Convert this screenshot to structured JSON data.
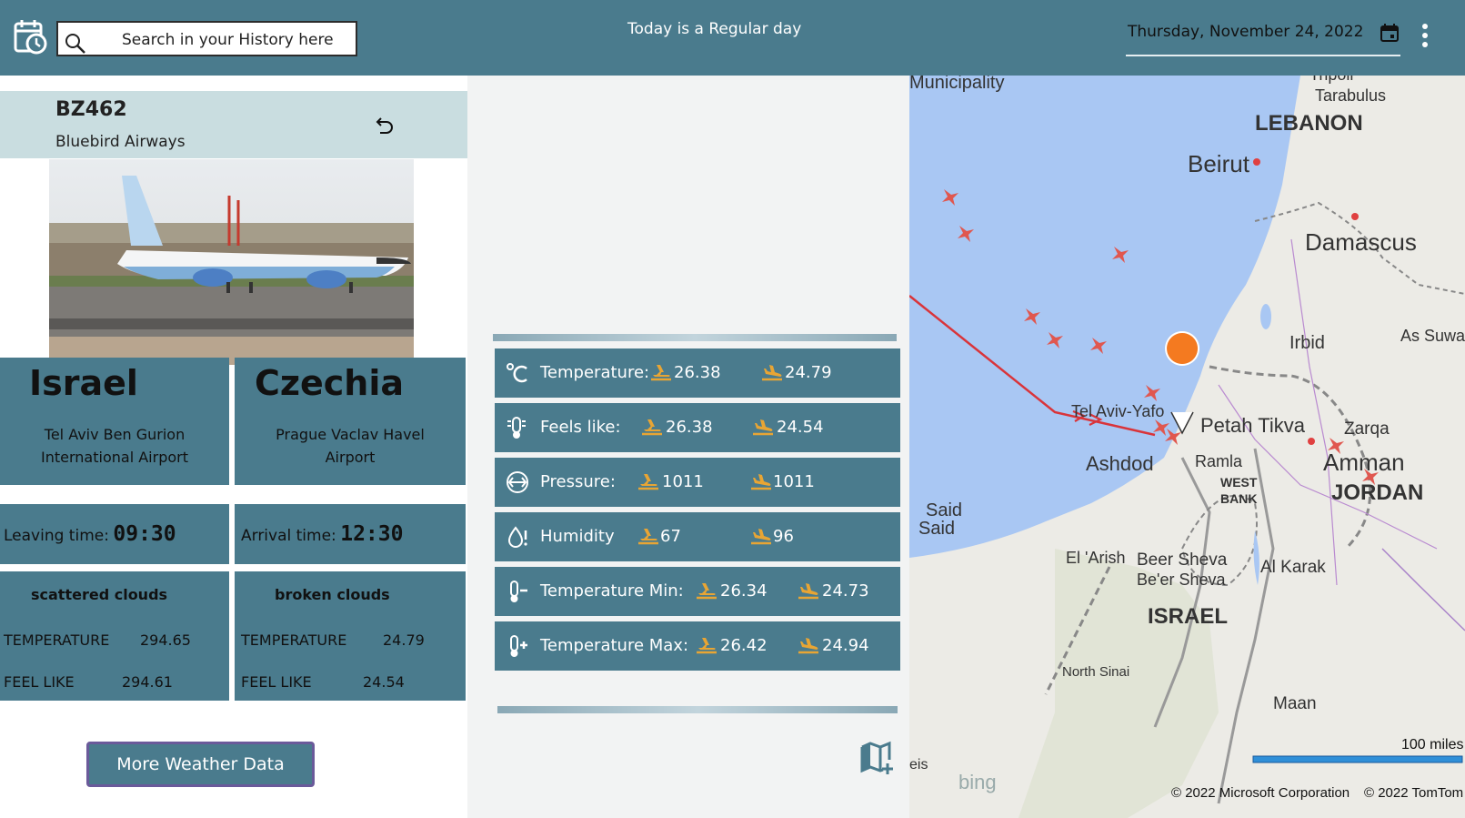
{
  "header": {
    "search_placeholder": "Search in your History here",
    "day_text": "Today is a Regular day",
    "date_text": "Thursday, November 24, 2022"
  },
  "flight": {
    "code": "BZ462",
    "airline": "Bluebird Airways"
  },
  "origin": {
    "country": "Israel",
    "airport": "Tel Aviv Ben Gurion International Airport",
    "airport_line1": "Tel Aviv Ben Gurion",
    "airport_line2": "International Airport",
    "time_label": "Leaving time:",
    "time_value": "09:30",
    "condition": "scattered clouds",
    "temp_label": "TEMPERATURE",
    "temp_value": "294.65",
    "feel_label": "FEEL LIKE",
    "feel_value": "294.61"
  },
  "destination": {
    "country": "Czechia",
    "airport_line1": "Prague Vaclav Havel",
    "airport_line2": "Airport",
    "time_label": "Arrival time:",
    "time_value": "12:30",
    "condition": "broken clouds",
    "temp_label": "TEMPERATURE",
    "temp_value": "24.79",
    "feel_label": "FEEL LIKE",
    "feel_value": "24.54"
  },
  "more_weather_button": "More Weather Data",
  "weather_rows": [
    {
      "icon": "celsius-icon",
      "label": "Temperature:",
      "departure": "26.38",
      "arrival": "24.79"
    },
    {
      "icon": "thermometer-feel-icon",
      "label": "Feels like:",
      "departure": "26.38",
      "arrival": "24.54"
    },
    {
      "icon": "pressure-gauge-icon",
      "label": "Pressure:",
      "departure": "1011",
      "arrival": "1011"
    },
    {
      "icon": "humidity-icon",
      "label": "Humidity",
      "departure": "67",
      "arrival": "96"
    },
    {
      "icon": "thermometer-minus-icon",
      "label": "Temperature Min:",
      "departure": "26.34",
      "arrival": "24.73"
    },
    {
      "icon": "thermometer-plus-icon",
      "label": "Temperature Max:",
      "departure": "26.42",
      "arrival": "24.94"
    }
  ],
  "colors": {
    "primary": "#4a7b8d",
    "header_band": "#c9dde0",
    "accent_plane": "#e8a534",
    "route_line": "#d9343a"
  },
  "map": {
    "labels": {
      "municipality": "Municipality",
      "tripoli": "Tripoli",
      "tarabulus": "Tarabulus",
      "lebanon": "LEBANON",
      "beirut": "Beirut",
      "damascus": "Damascus",
      "irbid": "Irbid",
      "as_suwa": "As Suwa",
      "tel_aviv": "Tel Aviv-Yafo",
      "petah_tikva": "Petah Tikva",
      "zarqa": "Zarqa",
      "ashdod": "Ashdod",
      "ramla": "Ramla",
      "amman": "Amman",
      "jordan": "JORDAN",
      "west_bank_1": "WEST",
      "west_bank_2": "BANK",
      "said_1": "Said",
      "said_2": "Said",
      "el_arish": "El 'Arish",
      "beer_sheva": "Beer Sheva",
      "be_er_sheva": "Be'er Sheva",
      "al_karak": "Al Karak",
      "israel": "ISRAEL",
      "north_sinai": "North Sinai",
      "maan": "Maan",
      "eis": "eis"
    },
    "scale": "100 miles",
    "attribution_ms": "© 2022 Microsoft Corporation",
    "attribution_tt": "© 2022 TomTom",
    "bing": "bing"
  }
}
